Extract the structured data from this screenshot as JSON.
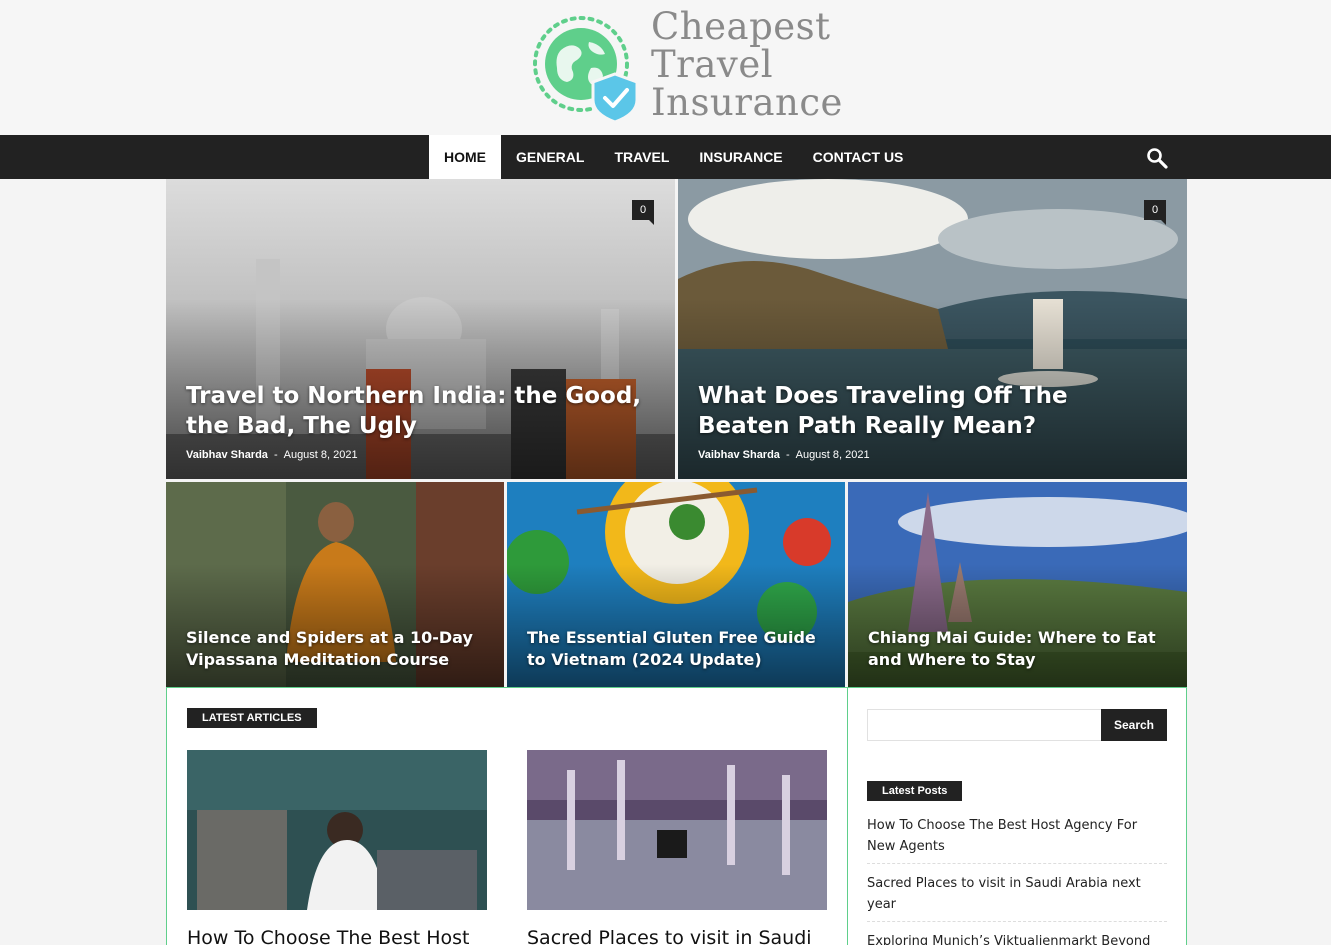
{
  "logo": {
    "lines": [
      "Cheapest",
      "Travel",
      "Insurance"
    ],
    "icon": "globe-shield-icon"
  },
  "nav": {
    "items": [
      {
        "label": "HOME",
        "active": true
      },
      {
        "label": "GENERAL"
      },
      {
        "label": "TRAVEL"
      },
      {
        "label": "INSURANCE"
      },
      {
        "label": "CONTACT US"
      }
    ],
    "search_icon": "search-icon"
  },
  "featured": {
    "big": [
      {
        "title": "Travel to Northern India: the Good, the Bad, The Ugly",
        "author": "Vaibhav Sharda",
        "date": "August 8, 2021",
        "comments": "0"
      },
      {
        "title": "What Does Traveling Off The Beaten Path Really Mean?",
        "author": "Vaibhav Sharda",
        "date": "August 8, 2021",
        "comments": "0"
      }
    ],
    "small": [
      {
        "title": "Silence and Spiders at a 10-Day Vipassana Meditation Course"
      },
      {
        "title": "The Essential Gluten Free Guide to Vietnam (2024 Update)"
      },
      {
        "title": "Chiang Mai Guide: Where to Eat and Where to Stay"
      }
    ]
  },
  "latest_articles": {
    "label": "LATEST ARTICLES",
    "items": [
      {
        "title": "How To Choose The Best Host"
      },
      {
        "title": "Sacred Places to visit in Saudi"
      }
    ]
  },
  "sidebar": {
    "search_placeholder": "",
    "search_button": "Search",
    "latest_posts_label": "Latest Posts",
    "posts": [
      "How To Choose The Best Host Agency For New Agents",
      "Sacred Places to visit in Saudi Arabia next year",
      "Exploring Munich’s Viktualienmarkt Beyond"
    ]
  },
  "colors": {
    "accent_green": "#5fcf8b",
    "dark": "#222222",
    "logo_text": "#8a8a8a"
  }
}
